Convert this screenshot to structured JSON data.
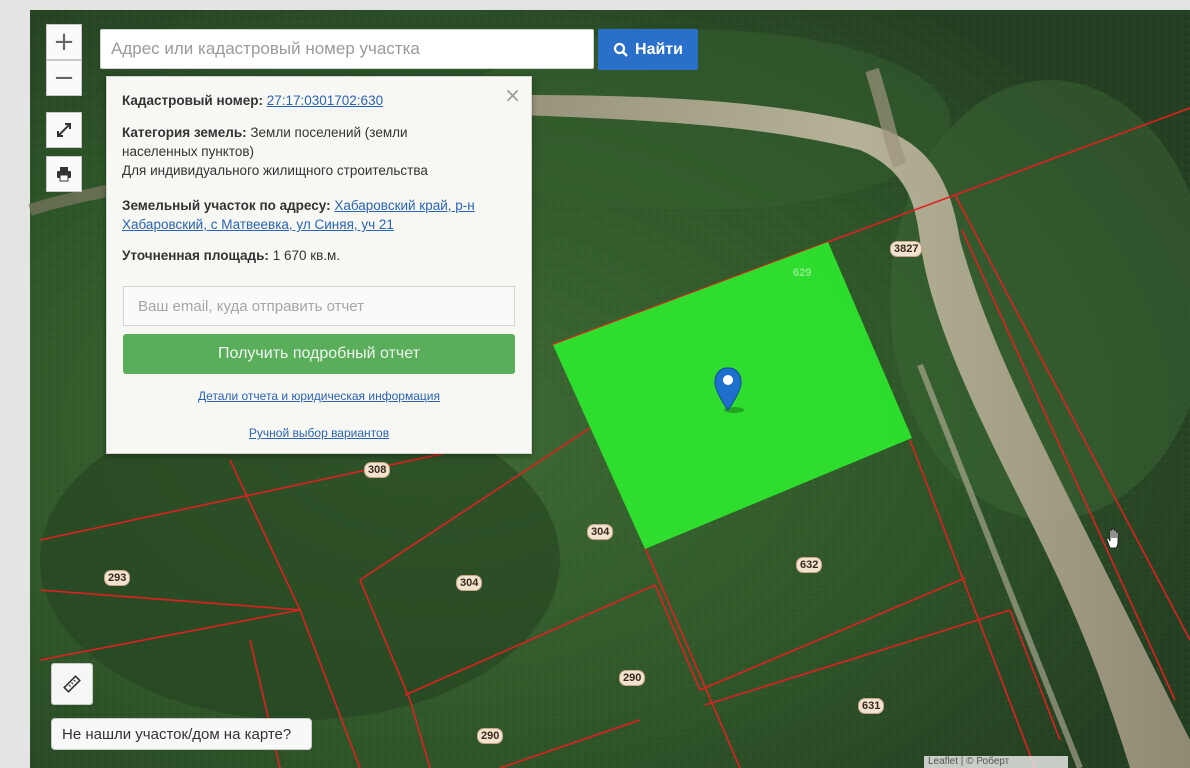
{
  "search": {
    "placeholder": "Адрес или кадастровый номер участка",
    "button_label": "Найти"
  },
  "controls": {
    "zoom_in": "+",
    "zoom_out": "−"
  },
  "popup": {
    "cadastral_label": "Кадастровый номер:",
    "cadastral_value": "27:17:0301702:630",
    "category_label": "Категория земель:",
    "category_value_line1": "Земли поселений (земли",
    "category_value_line2": "населенных пунктов)",
    "category_usage": "Для индивидуального жилищного строительства",
    "address_label": "Земельный участок по адресу:",
    "address_value_line1": "Хабаровский край, р-н",
    "address_value_line2": "Хабаровский, с Матвеевка, ул Синяя, уч 21",
    "area_label": "Уточненная площадь:",
    "area_value": "1 670 кв.м.",
    "email_placeholder": "Ваш email, куда отправить отчет",
    "report_button": "Получить подробный отчет",
    "details_link": "Детали отчета и юридическая информация",
    "manual_link": "Ручной выбор вариантов",
    "close_symbol": "×"
  },
  "map": {
    "parcel_labels": [
      {
        "id": "l3827",
        "text": "3827"
      },
      {
        "id": "l629",
        "text": "629"
      },
      {
        "id": "l308",
        "text": "308"
      },
      {
        "id": "l304a",
        "text": "304"
      },
      {
        "id": "l304b",
        "text": "304"
      },
      {
        "id": "l293",
        "text": "293"
      },
      {
        "id": "l632",
        "text": "632"
      },
      {
        "id": "l290a",
        "text": "290"
      },
      {
        "id": "l290b",
        "text": "290"
      },
      {
        "id": "l631",
        "text": "631"
      }
    ],
    "highlight_color": "#2ee82e",
    "boundary_color": "#e02020",
    "marker_color": "#1f6fcf"
  },
  "bottom": {
    "not_found_label": "Не нашли участок/дом на карте?",
    "attribution": "Leaflet | © Роберт"
  }
}
